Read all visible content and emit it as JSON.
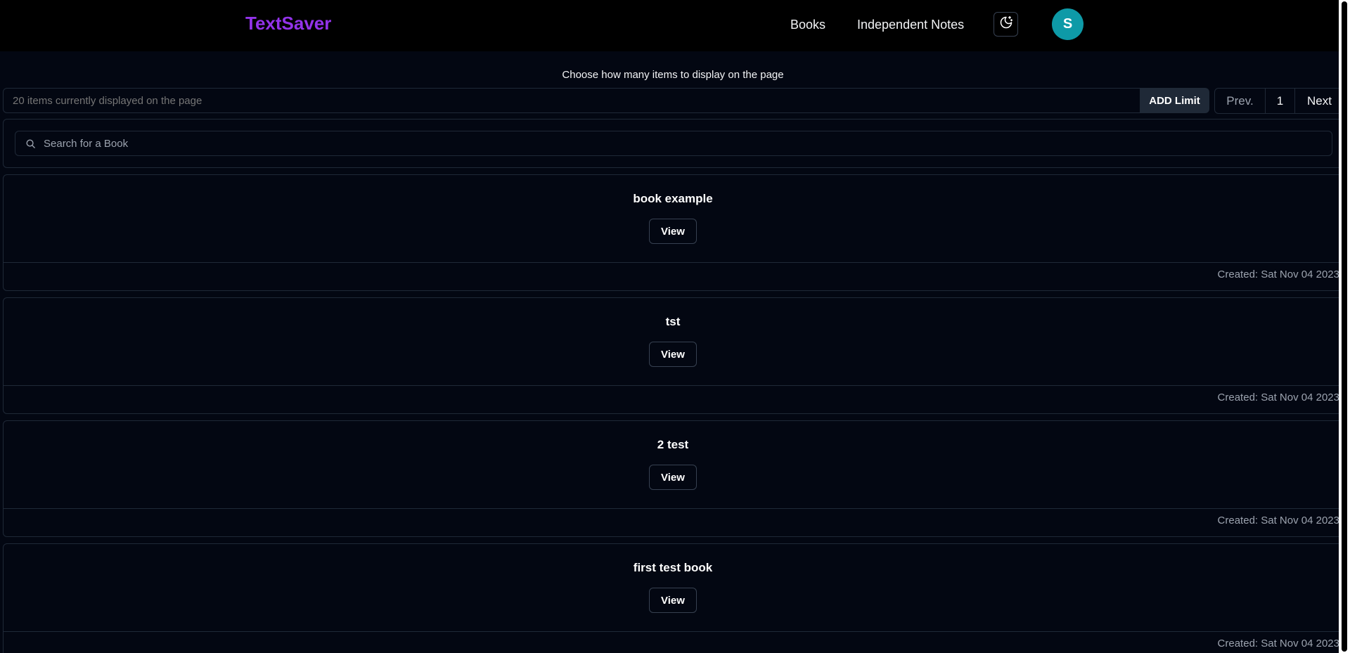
{
  "header": {
    "brand": "TextSaver",
    "nav": {
      "books": "Books",
      "independent_notes": "Independent Notes"
    },
    "theme_icon": "moon-stars-icon",
    "avatar_initial": "S",
    "colors": {
      "brand": "#9333ea",
      "avatar": "#0e9aa7"
    }
  },
  "limit": {
    "title": "Choose how many items to display on the page",
    "placeholder": "20 items currently displayed on the page",
    "add_label": "ADD Limit"
  },
  "pagination": {
    "prev": "Prev.",
    "page": "1",
    "next": "Next"
  },
  "search": {
    "placeholder": "Search for a Book",
    "icon": "search-icon"
  },
  "books": [
    {
      "title": "book example",
      "view_label": "View",
      "created": "Created: Sat Nov 04 2023"
    },
    {
      "title": "tst",
      "view_label": "View",
      "created": "Created: Sat Nov 04 2023"
    },
    {
      "title": "2 test",
      "view_label": "View",
      "created": "Created: Sat Nov 04 2023"
    },
    {
      "title": "first test book",
      "view_label": "View",
      "created": "Created: Sat Nov 04 2023"
    }
  ]
}
